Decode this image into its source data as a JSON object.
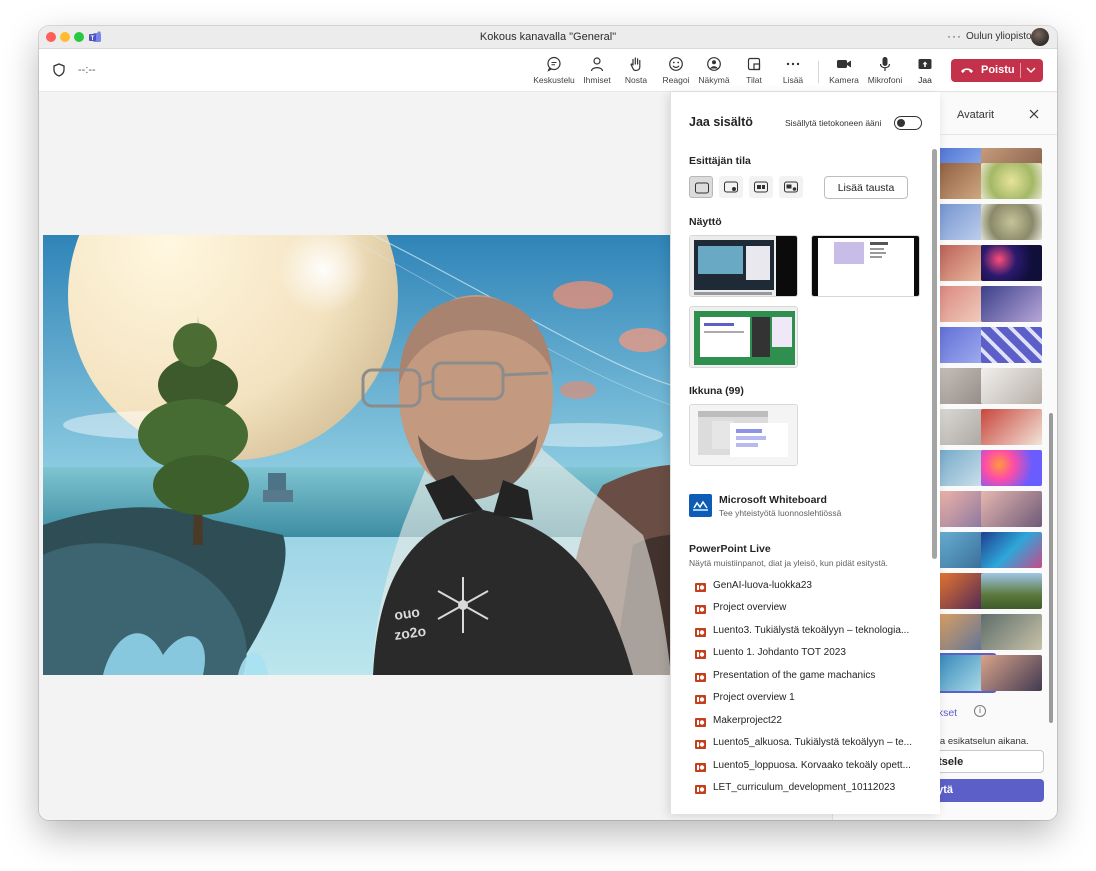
{
  "window": {
    "title": "Kokous kanavalla \"General\"",
    "more": "···",
    "org": "Oulun yliopisto"
  },
  "toolbar": {
    "timer": "--:--",
    "items": [
      {
        "label": "Keskustelu",
        "icon": "chat-icon"
      },
      {
        "label": "Ihmiset",
        "icon": "people-icon"
      },
      {
        "label": "Nosta",
        "icon": "raise-hand-icon"
      },
      {
        "label": "Reagoi",
        "icon": "react-icon"
      },
      {
        "label": "Näkymä",
        "icon": "view-icon"
      },
      {
        "label": "Tilat",
        "icon": "rooms-icon"
      },
      {
        "label": "Lisää",
        "icon": "more-icon"
      },
      {
        "label": "Kamera",
        "icon": "camera-icon"
      },
      {
        "label": "Mikrofoni",
        "icon": "microphone-icon"
      },
      {
        "label": "Jaa",
        "icon": "share-icon"
      }
    ],
    "leave_label": "Poistu",
    "colors": {
      "leave": "#c4314b",
      "accent": "#5b5fc7"
    }
  },
  "share": {
    "title": "Jaa sisältö",
    "toggle_label": "Sisällytä tietokoneen ääni",
    "presenter_mode_heading": "Esittäjän tila",
    "add_background": "Lisää tausta",
    "screen_heading": "Näyttö",
    "window_heading": "Ikkuna (99)",
    "whiteboard_title": "Microsoft Whiteboard",
    "whiteboard_sub": "Tee yhteistyötä luonnoslehtiössä",
    "powerpoint_heading": "PowerPoint Live",
    "powerpoint_sub": "Näytä muistiinpanot, diat ja yleisö, kun pidät esitystä.",
    "files": [
      "GenAI-luova-luokka23",
      "Project overview",
      "Luento3. Tukiälystä tekoälyyn – teknologia...",
      "Luento 1. Johdanto TOT 2023",
      "Presentation of the game machanics",
      "Project overview 1",
      "Makerproject22",
      "Luento5_alkuosa. Tukiälystä tekoälyyn – te...",
      "Luento5_loppuosa. Korvaako tekoäly opett...",
      "LET_curriculum_development_10112023"
    ]
  },
  "avatars": {
    "title": "Avatarit",
    "link": "ukset",
    "note": "ota esikatselun aikana.",
    "preview_button": "atsele",
    "apply_button": "äytä"
  }
}
